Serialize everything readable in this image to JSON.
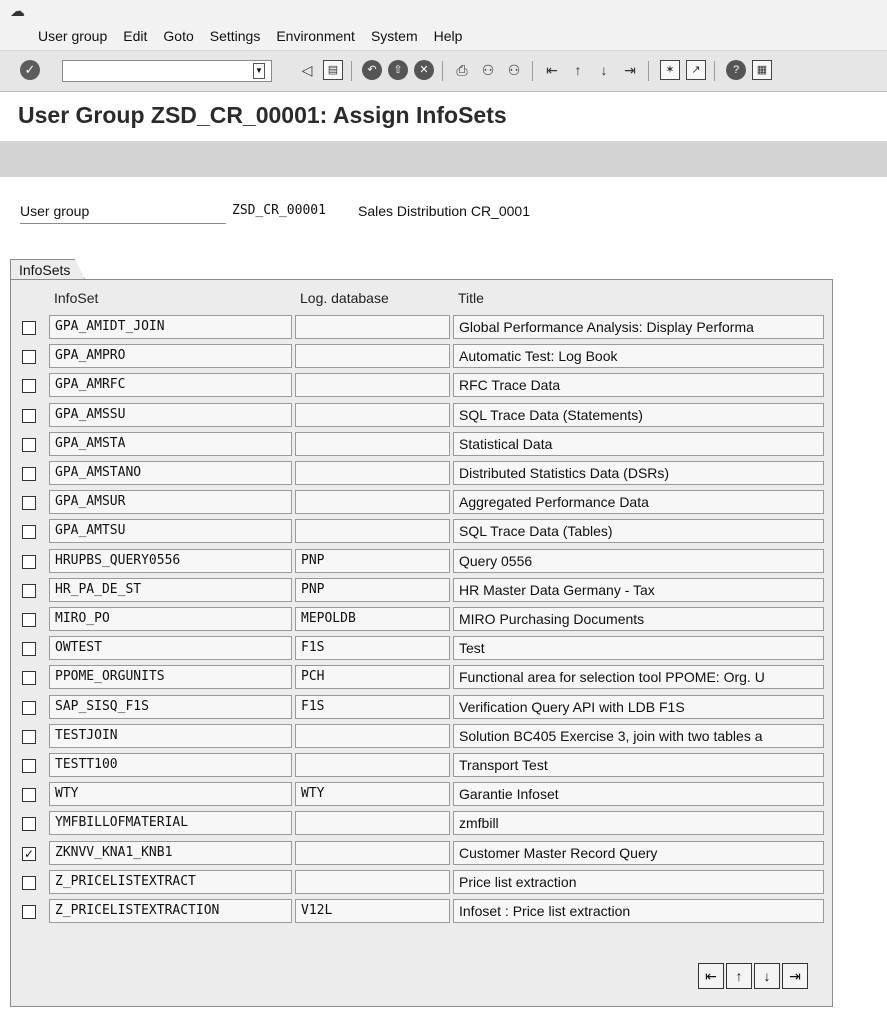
{
  "menu": {
    "corner_icon": "exit-menu-icon",
    "items": [
      "User group",
      "Edit",
      "Goto",
      "Settings",
      "Environment",
      "System",
      "Help"
    ]
  },
  "toolbar": {
    "command_value": "",
    "icons": [
      "enter-icon",
      "back-arrow-icon",
      "save-icon",
      "back-icon",
      "exit-icon",
      "cancel-icon",
      "print-icon",
      "find-icon",
      "find-next-icon",
      "first-page-icon",
      "previous-page-icon",
      "next-page-icon",
      "last-page-icon",
      "new-session-icon",
      "shortcut-icon",
      "help-icon",
      "customize-layout-icon"
    ]
  },
  "page": {
    "title": "User Group ZSD_CR_00001: Assign InfoSets"
  },
  "user_group": {
    "label": "User group",
    "value": "ZSD_CR_00001",
    "description": "Sales Distribution CR_0001"
  },
  "infosets": {
    "tab_label": "InfoSets",
    "columns": {
      "infoset": "InfoSet",
      "log_database": "Log. database",
      "title": "Title"
    },
    "rows": [
      {
        "infoset": "GPA_AMIDT_JOIN",
        "ldb": "",
        "title": "Global Performance Analysis: Display Performa",
        "checked": false
      },
      {
        "infoset": "GPA_AMPRO",
        "ldb": "",
        "title": "Automatic Test: Log Book",
        "checked": false
      },
      {
        "infoset": "GPA_AMRFC",
        "ldb": "",
        "title": "RFC Trace Data",
        "checked": false
      },
      {
        "infoset": "GPA_AMSSU",
        "ldb": "",
        "title": "SQL Trace Data (Statements)",
        "checked": false
      },
      {
        "infoset": "GPA_AMSTA",
        "ldb": "",
        "title": "Statistical Data",
        "checked": false
      },
      {
        "infoset": "GPA_AMSTANO",
        "ldb": "",
        "title": "Distributed Statistics Data (DSRs)",
        "checked": false
      },
      {
        "infoset": "GPA_AMSUR",
        "ldb": "",
        "title": "Aggregated Performance Data",
        "checked": false
      },
      {
        "infoset": "GPA_AMTSU",
        "ldb": "",
        "title": "SQL Trace Data (Tables)",
        "checked": false
      },
      {
        "infoset": "HRUPBS_QUERY0556",
        "ldb": "PNP",
        "title": "Query 0556",
        "checked": false
      },
      {
        "infoset": "HR_PA_DE_ST",
        "ldb": "PNP",
        "title": "HR Master Data Germany - Tax",
        "checked": false
      },
      {
        "infoset": "MIRO_PO",
        "ldb": "MEPOLDB",
        "title": "MIRO Purchasing Documents",
        "checked": false
      },
      {
        "infoset": "OWTEST",
        "ldb": "F1S",
        "title": "Test",
        "checked": false
      },
      {
        "infoset": "PPOME_ORGUNITS",
        "ldb": "PCH",
        "title": "Functional area for selection tool PPOME: Org. U",
        "checked": false
      },
      {
        "infoset": "SAP_SISQ_F1S",
        "ldb": "F1S",
        "title": "Verification Query API with LDB F1S",
        "checked": false
      },
      {
        "infoset": "TESTJOIN",
        "ldb": "",
        "title": "Solution BC405 Exercise 3, join with two tables a",
        "checked": false
      },
      {
        "infoset": "TESTT100",
        "ldb": "",
        "title": "Transport Test",
        "checked": false
      },
      {
        "infoset": "WTY",
        "ldb": "WTY",
        "title": "Garantie Infoset",
        "checked": false
      },
      {
        "infoset": "YMFBILLOFMATERIAL",
        "ldb": "",
        "title": "zmfbill",
        "checked": false
      },
      {
        "infoset": "ZKNVV_KNA1_KNB1",
        "ldb": "",
        "title": "Customer Master Record Query",
        "checked": true
      },
      {
        "infoset": "Z_PRICELISTEXTRACT",
        "ldb": "",
        "title": "Price list extraction",
        "checked": false
      },
      {
        "infoset": "Z_PRICELISTEXTRACTION",
        "ldb": "V12L",
        "title": "Infoset : Price list extraction",
        "checked": false
      }
    ],
    "nav_buttons": [
      "first-page-icon",
      "previous-page-icon",
      "next-page-icon",
      "last-page-icon"
    ]
  }
}
